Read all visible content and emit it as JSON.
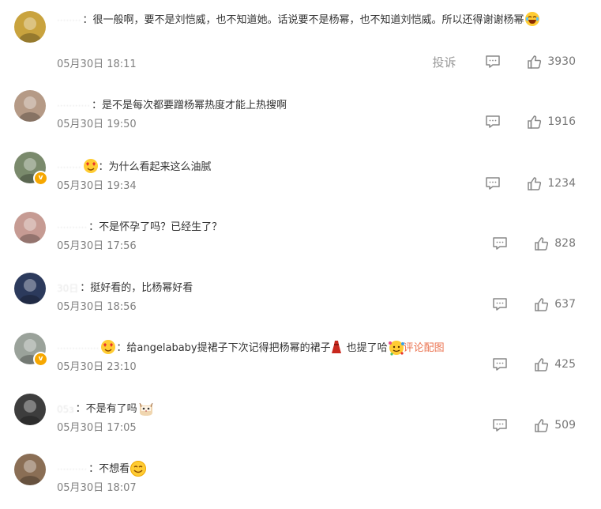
{
  "comments": [
    {
      "username": "········",
      "text": "很一般啊，要不是刘恺威，也不知道她。话说要不是杨幂，也不知道刘恺威。所以还得谢谢杨幂",
      "emoji_after": "laughing-tears-emoji",
      "timestamp": "05月30日 18:11",
      "report": "投诉",
      "likes": "3930",
      "avatar_color": "#c9a33e"
    },
    {
      "username": "···········",
      "text": "是不是每次都要蹭杨幂热度才能上热搜啊",
      "timestamp": "05月30日 19:50",
      "likes": "1916",
      "avatar_color": "#b59a86"
    },
    {
      "username": "········",
      "prefix_emoji": "heart-eyes-emoji",
      "text": "为什么看起来这么油腻",
      "timestamp": "05月30日 19:34",
      "likes": "1234",
      "verified": true,
      "avatar_color": "#7a8a6c"
    },
    {
      "username": "··········",
      "text": "不是怀孕了吗？已经生了？",
      "timestamp": "05月30日 17:56",
      "likes": "828",
      "avatar_color": "#c69b93"
    },
    {
      "username": "30日",
      "text": "挺好看的，比杨幂好看",
      "timestamp": "05月30日 18:56",
      "likes": "637",
      "avatar_color": "#2c3a5c"
    },
    {
      "username": "··············",
      "prefix_emoji": "heart-eyes-emoji",
      "text": "给angelababy提裙子下次记得把杨幂的裙子",
      "mid_emoji": "red-dress-emoji",
      "text2": "也提了哈",
      "end_emoji": "party-face-emoji",
      "link": "评论配图",
      "timestamp": "05月30日 23:10",
      "likes": "425",
      "verified": true,
      "avatar_color": "#9aa29a"
    },
    {
      "username": "05з",
      "text": "不是有了吗",
      "emoji_after": "cat-emoji",
      "timestamp": "05月30日 17:05",
      "likes": "509",
      "avatar_color": "#3d3d3d"
    },
    {
      "username": "··········",
      "text": "不想看",
      "emoji_after": "smile-emoji",
      "timestamp": "05月30日 18:07",
      "likes": "",
      "avatar_color": "#8a6e55"
    }
  ]
}
